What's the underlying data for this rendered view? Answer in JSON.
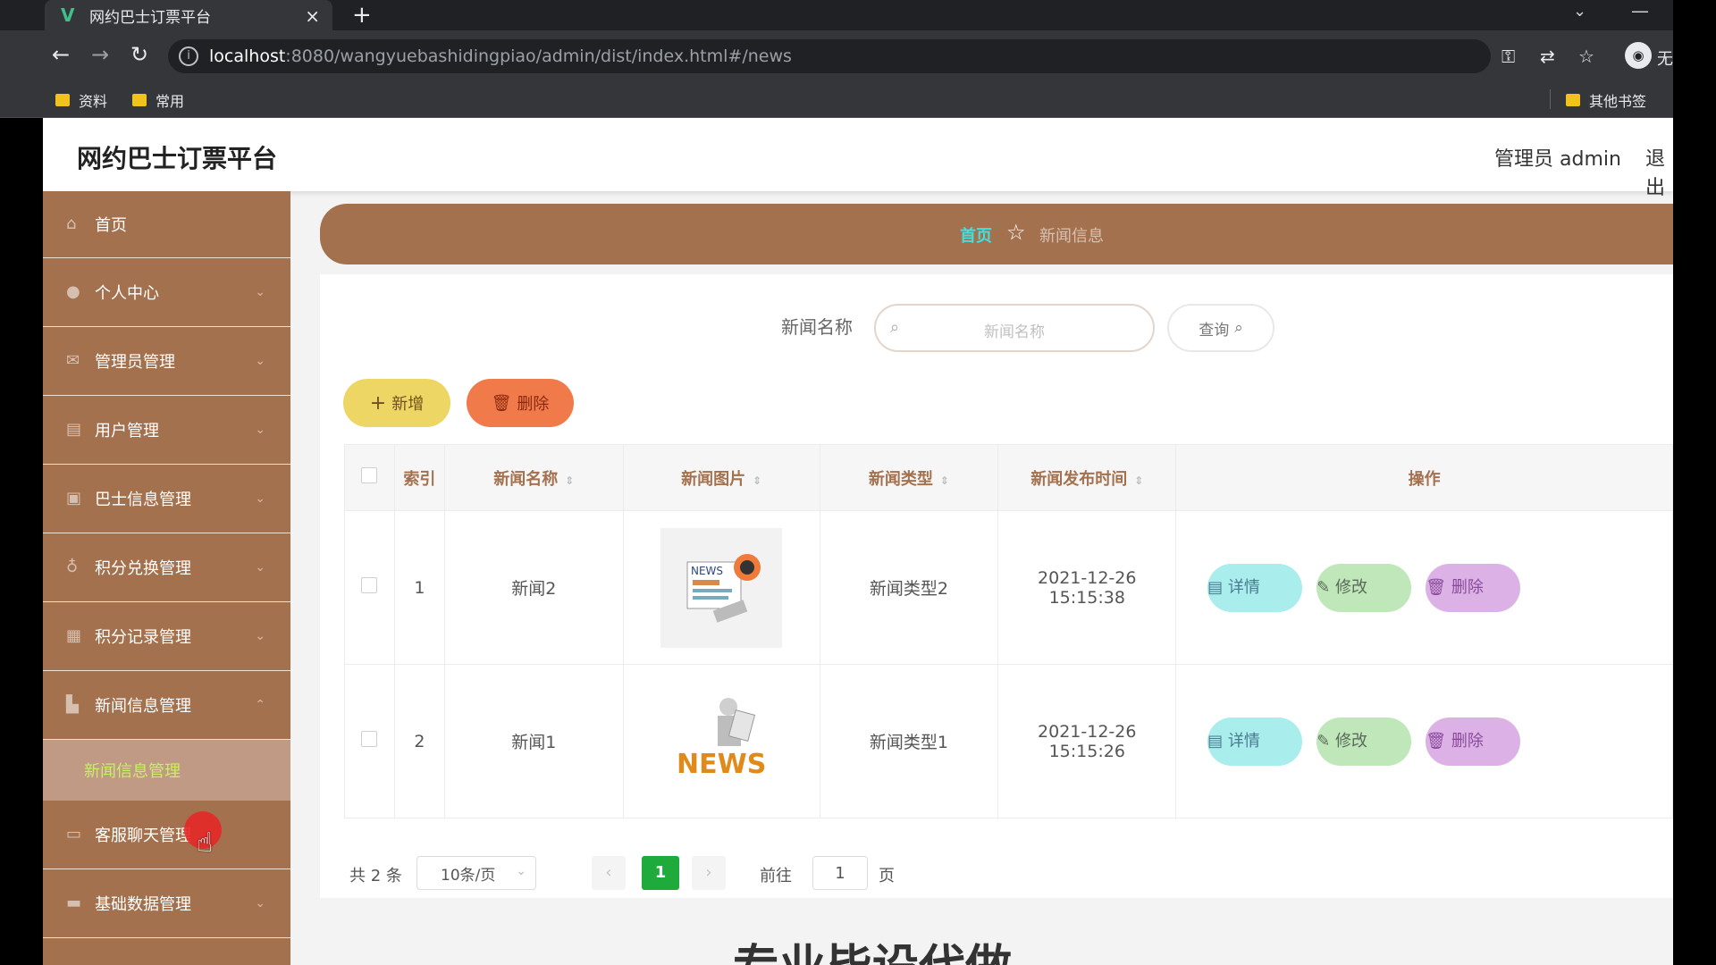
{
  "browser": {
    "tab_title": "网约巴士订票平台",
    "tab_favicon": "V",
    "tab_close": "×",
    "new_tab": "+",
    "url_host": "localhost",
    "url_path": ":8080/wangyuebashidingpiao/admin/dist/index.html#/news",
    "profile_label": "无",
    "bookmarks": [
      "资料",
      "常用"
    ],
    "other_bookmarks": "其他书签"
  },
  "header": {
    "title": "网约巴士订票平台",
    "user": "管理员 admin",
    "logout": "退出"
  },
  "sidebar": {
    "items": [
      {
        "label": "首页",
        "icon": "home-icon"
      },
      {
        "label": "个人中心",
        "icon": "user-icon"
      },
      {
        "label": "管理员管理",
        "icon": "mail-icon"
      },
      {
        "label": "用户管理",
        "icon": "clipboard-icon"
      },
      {
        "label": "巴士信息管理",
        "icon": "picture-icon"
      },
      {
        "label": "积分兑换管理",
        "icon": "mic-icon"
      },
      {
        "label": "积分记录管理",
        "icon": "grid-icon"
      },
      {
        "label": "新闻信息管理",
        "icon": "chart-icon"
      }
    ],
    "sub_item": "新闻信息管理",
    "after_items": [
      {
        "label": "客服聊天管理",
        "icon": "chat-icon"
      },
      {
        "label": "基础数据管理",
        "icon": "data-icon"
      }
    ]
  },
  "breadcrumb": {
    "home": "首页",
    "current": "新闻信息"
  },
  "search": {
    "label": "新闻名称",
    "placeholder": "新闻名称",
    "button": "查询"
  },
  "actions": {
    "add": "新增",
    "delete": "删除"
  },
  "table": {
    "headers": [
      "索引",
      "新闻名称",
      "新闻图片",
      "新闻类型",
      "新闻发布时间",
      "操作"
    ],
    "rows": [
      {
        "index": "1",
        "name": "新闻2",
        "image": "news-newspaper-image",
        "type": "新闻类型2",
        "time": "2021-12-26 15:15:38"
      },
      {
        "index": "2",
        "name": "新闻1",
        "image": "news-reader-image",
        "type": "新闻类型1",
        "time": "2021-12-26 15:15:26"
      }
    ],
    "row_actions": {
      "detail": "详情",
      "edit": "修改",
      "delete": "删除"
    }
  },
  "pager": {
    "total": "共 2 条",
    "page_size": "10条/页",
    "current_page": "1",
    "goto_label": "前往",
    "goto_value": "1",
    "page_suffix": "页"
  },
  "footer_text": "专业毕设代做",
  "colors": {
    "accent": "#a4714e",
    "active_page": "#1faa3c",
    "add_button": "#eed664",
    "delete_button": "#f07a4a"
  }
}
